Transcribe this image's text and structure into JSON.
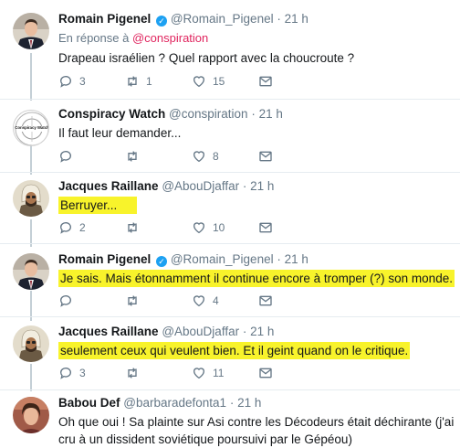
{
  "tweets": [
    {
      "name": "Romain Pigenel",
      "verified": true,
      "handle": "@Romain_Pigenel",
      "time": "21 h",
      "reply_prefix": "En réponse à",
      "reply_mention": "@conspiration",
      "text": "Drapeau israélien ? Quel rapport avec la choucroute ?",
      "highlighted": false,
      "replies": "3",
      "retweets": "1",
      "likes": "15"
    },
    {
      "name": "Conspiracy Watch",
      "verified": false,
      "handle": "@conspiration",
      "time": "21 h",
      "text": "Il faut leur demander...",
      "highlighted": false,
      "replies": "",
      "retweets": "",
      "likes": "8"
    },
    {
      "name": "Jacques Raillane",
      "verified": false,
      "handle": "@AbouDjaffar",
      "time": "21 h",
      "text": "Berruyer...",
      "highlighted": true,
      "replies": "2",
      "retweets": "",
      "likes": "10"
    },
    {
      "name": "Romain Pigenel",
      "verified": true,
      "handle": "@Romain_Pigenel",
      "time": "21 h",
      "text": "Je sais. Mais étonnamment il continue encore à tromper (?) son monde.",
      "highlighted": true,
      "replies": "",
      "retweets": "",
      "likes": "4"
    },
    {
      "name": "Jacques Raillane",
      "verified": false,
      "handle": "@AbouDjaffar",
      "time": "21 h",
      "text": "seulement ceux qui veulent bien. Et il geint quand on le critique.",
      "highlighted": true,
      "replies": "3",
      "retweets": "",
      "likes": "11"
    },
    {
      "name": "Babou Def",
      "verified": false,
      "handle": "@barbaradefonta1",
      "time": "21 h",
      "text": "Oh que oui ! Sa plainte sur Asi contre les Décodeurs était déchirante (j'ai cru à un dissident soviétique poursuivi par le Gépéou)",
      "highlighted": false
    }
  ],
  "avatars": {
    "cw_logo_text": "Conspiracy Watch"
  },
  "colors": {
    "highlight": "#f8f32b",
    "verified": "#1da1f2",
    "mention": "#e0245e",
    "muted": "#657786"
  }
}
